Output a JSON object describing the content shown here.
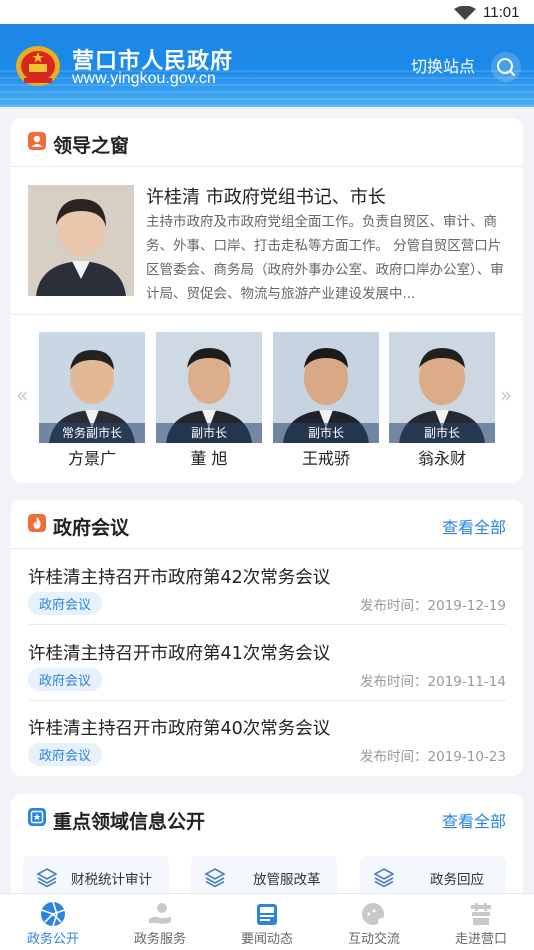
{
  "status_bar": {
    "time": "11:01"
  },
  "header": {
    "title": "营口市人民政府",
    "url": "www.yingkou.gov.cn",
    "switch_site_label": "切换站点"
  },
  "leaders": {
    "section_title": "领导之窗",
    "main_leader": {
      "name_title": "许桂清 市政府党组书记、市长",
      "description": "主持市政府及市政府党组全面工作。负责自贸区、审计、商务、外事、口岸、打击走私等方面工作。 分管自贸区营口片区管委会、商务局（政府外事办公室、政府口岸办公室）、审计局、贸促会、物流与旅游产业建设发展中..."
    },
    "deputies": [
      {
        "role": "常务副市长",
        "name": "方景广"
      },
      {
        "role": "副市长",
        "name": "董 旭"
      },
      {
        "role": "副市长",
        "name": "王戒骄"
      },
      {
        "role": "副市长",
        "name": "翁永财"
      }
    ],
    "prev_arrow": "«",
    "next_arrow": "»"
  },
  "meetings": {
    "section_title": "政府会议",
    "more_label": "查看全部",
    "items": [
      {
        "title": "许桂清主持召开市政府第42次常务会议",
        "tag": "政府会议",
        "date": "发布时间：2019-12-19"
      },
      {
        "title": "许桂清主持召开市政府第41次常务会议",
        "tag": "政府会议",
        "date": "发布时间：2019-11-14"
      },
      {
        "title": "许桂清主持召开市政府第40次常务会议",
        "tag": "政府会议",
        "date": "发布时间：2019-10-23"
      }
    ]
  },
  "key_areas": {
    "section_title": "重点领域信息公开",
    "more_label": "查看全部",
    "items": [
      {
        "label": "财税统计审计",
        "icon": "layers-icon"
      },
      {
        "label": "放管服改革",
        "icon": "layers-icon"
      },
      {
        "label": "政务回应",
        "icon": "layers-icon"
      }
    ]
  },
  "tabbar": {
    "tabs": [
      {
        "label": "政务公开",
        "icon": "aperture-icon",
        "active": true
      },
      {
        "label": "政务服务",
        "icon": "hand-service-icon",
        "active": false
      },
      {
        "label": "要闻动态",
        "icon": "newspaper-icon",
        "active": false
      },
      {
        "label": "互动交流",
        "icon": "chat-icon",
        "active": false
      },
      {
        "label": "走进营口",
        "icon": "building-icon",
        "active": false
      }
    ]
  },
  "colors": {
    "accent": "#2a84e0",
    "header_blue": "#1f86e6",
    "tag_bg": "#e7f1fc",
    "icon_orange": "#f26b3a"
  }
}
